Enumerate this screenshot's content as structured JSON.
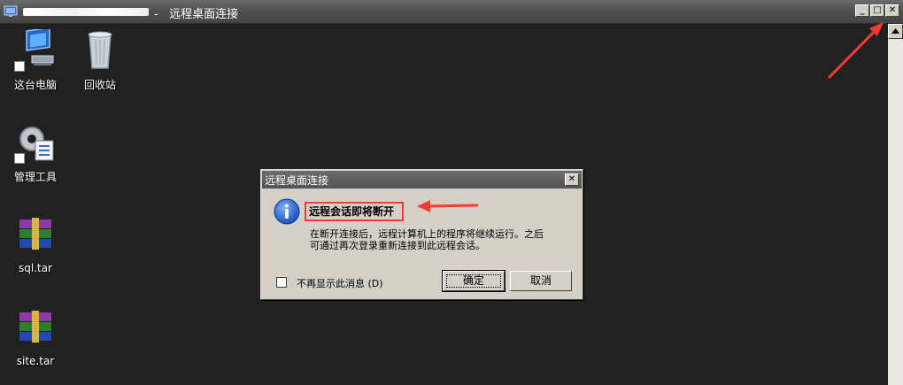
{
  "window": {
    "title": "远程桌面连接",
    "title_separator": "-",
    "controls": {
      "minimize_icon": "minimize-icon",
      "maximize_icon": "maximize-icon",
      "close_icon": "close-icon"
    }
  },
  "desktop": {
    "icons": [
      {
        "label": "这台电脑",
        "icon": "computer-icon"
      },
      {
        "label": "回收站",
        "icon": "recycle-bin-icon"
      },
      {
        "label": "管理工具",
        "icon": "admin-tools-icon"
      },
      {
        "label": "sql.tar",
        "icon": "archive-icon"
      },
      {
        "label": "site.tar",
        "icon": "archive-icon"
      }
    ]
  },
  "dialog": {
    "title": "远程桌面连接",
    "close_label": "✕",
    "heading": "远程会话即将断开",
    "body_line1": "在断开连接后，远程计算机上的程序将继续运行。之后",
    "body_line2": "可通过再次登录重新连接到此远程会话。",
    "checkbox_label": "不再显示此消息 (D)",
    "checkbox_checked": false,
    "ok_label": "确定",
    "cancel_label": "取消"
  },
  "colors": {
    "annotation": "#ff3b30",
    "desktop_bg": "#212121",
    "titlebar": "#4e4e4e"
  }
}
